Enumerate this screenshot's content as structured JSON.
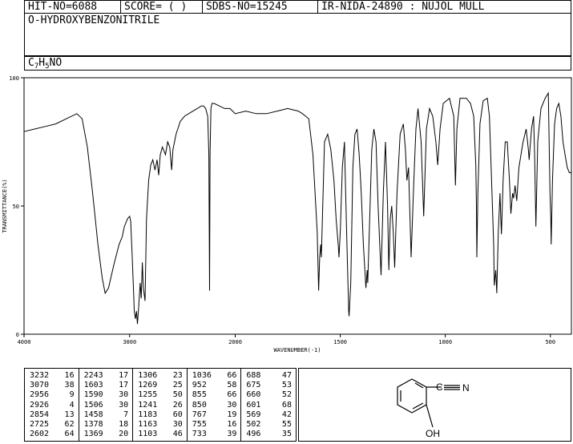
{
  "header": {
    "hit_no": "HIT-NO=6088",
    "score": "SCORE=  (  )",
    "sdbs_no": "SDBS-NO=15245",
    "ir_nida": "IR-NIDA-24890 : NUJOL MULL"
  },
  "compound": {
    "name": "O-HYDROXYBENZONITRILE",
    "formula_c": "C",
    "formula_c_sub": "7",
    "formula_h": "H",
    "formula_h_sub": "5",
    "formula_rest": "NO"
  },
  "structure": {
    "nitrogen_label": "N",
    "hydroxyl_label": "OH"
  },
  "peak_table": {
    "columns": [
      [
        [
          "3232",
          "16"
        ],
        [
          "3070",
          "38"
        ],
        [
          "2956",
          "9"
        ],
        [
          "2926",
          "4"
        ],
        [
          "2854",
          "13"
        ],
        [
          "2725",
          "62"
        ],
        [
          "2602",
          "64"
        ]
      ],
      [
        [
          "2243",
          "17"
        ],
        [
          "1603",
          "17"
        ],
        [
          "1590",
          "30"
        ],
        [
          "1506",
          "30"
        ],
        [
          "1458",
          "7"
        ],
        [
          "1378",
          "18"
        ],
        [
          "1369",
          "20"
        ]
      ],
      [
        [
          "1306",
          "23"
        ],
        [
          "1269",
          "25"
        ],
        [
          "1255",
          "50"
        ],
        [
          "1241",
          "26"
        ],
        [
          "1183",
          "60"
        ],
        [
          "1163",
          "30"
        ],
        [
          "1103",
          "46"
        ]
      ],
      [
        [
          "1036",
          "66"
        ],
        [
          "952",
          "58"
        ],
        [
          "855",
          "66"
        ],
        [
          "850",
          "30"
        ],
        [
          "767",
          "19"
        ],
        [
          "755",
          "16"
        ],
        [
          "733",
          "39"
        ]
      ],
      [
        [
          "688",
          "47"
        ],
        [
          "675",
          "53"
        ],
        [
          "660",
          "52"
        ],
        [
          "601",
          "68"
        ],
        [
          "569",
          "42"
        ],
        [
          "502",
          "55"
        ],
        [
          "496",
          "35"
        ]
      ]
    ]
  },
  "chart_data": {
    "type": "line",
    "title": "",
    "xlabel": "WAVENUMBER(-1)",
    "ylabel": "TRANSMITTANCE(%)",
    "xlim": [
      4000,
      400
    ],
    "ylim": [
      0,
      100
    ],
    "x_ticks": [
      4000,
      3000,
      2000,
      1500,
      1000,
      500
    ],
    "y_ticks": [
      0,
      50,
      100
    ],
    "grid": false,
    "series": [
      {
        "color": "#000000",
        "points": [
          [
            4000,
            79
          ],
          [
            3900,
            80
          ],
          [
            3800,
            81
          ],
          [
            3700,
            82
          ],
          [
            3600,
            84
          ],
          [
            3500,
            86
          ],
          [
            3450,
            84
          ],
          [
            3400,
            73
          ],
          [
            3350,
            55
          ],
          [
            3300,
            35
          ],
          [
            3260,
            22
          ],
          [
            3232,
            16
          ],
          [
            3200,
            18
          ],
          [
            3150,
            27
          ],
          [
            3100,
            35
          ],
          [
            3070,
            38
          ],
          [
            3050,
            42
          ],
          [
            3020,
            45
          ],
          [
            3000,
            46
          ],
          [
            2990,
            44
          ],
          [
            2975,
            30
          ],
          [
            2960,
            14
          ],
          [
            2956,
            9
          ],
          [
            2945,
            6
          ],
          [
            2935,
            9
          ],
          [
            2926,
            4
          ],
          [
            2915,
            10
          ],
          [
            2900,
            20
          ],
          [
            2890,
            14
          ],
          [
            2880,
            28
          ],
          [
            2870,
            18
          ],
          [
            2860,
            15
          ],
          [
            2854,
            13
          ],
          [
            2840,
            45
          ],
          [
            2820,
            60
          ],
          [
            2800,
            66
          ],
          [
            2780,
            68
          ],
          [
            2760,
            64
          ],
          [
            2740,
            68
          ],
          [
            2725,
            62
          ],
          [
            2710,
            70
          ],
          [
            2690,
            73
          ],
          [
            2660,
            70
          ],
          [
            2640,
            75
          ],
          [
            2620,
            73
          ],
          [
            2602,
            64
          ],
          [
            2590,
            72
          ],
          [
            2560,
            78
          ],
          [
            2520,
            83
          ],
          [
            2480,
            85
          ],
          [
            2440,
            86
          ],
          [
            2400,
            87
          ],
          [
            2360,
            88
          ],
          [
            2320,
            89
          ],
          [
            2300,
            89
          ],
          [
            2280,
            88
          ],
          [
            2260,
            85
          ],
          [
            2250,
            70
          ],
          [
            2243,
            17
          ],
          [
            2238,
            70
          ],
          [
            2230,
            88
          ],
          [
            2220,
            90
          ],
          [
            2200,
            90
          ],
          [
            2150,
            89
          ],
          [
            2100,
            88
          ],
          [
            2050,
            88
          ],
          [
            2000,
            86
          ],
          [
            1950,
            87
          ],
          [
            1900,
            86
          ],
          [
            1850,
            86
          ],
          [
            1800,
            87
          ],
          [
            1750,
            88
          ],
          [
            1700,
            87
          ],
          [
            1680,
            86
          ],
          [
            1650,
            84
          ],
          [
            1630,
            70
          ],
          [
            1610,
            40
          ],
          [
            1603,
            17
          ],
          [
            1598,
            30
          ],
          [
            1593,
            35
          ],
          [
            1590,
            30
          ],
          [
            1585,
            45
          ],
          [
            1575,
            75
          ],
          [
            1560,
            78
          ],
          [
            1545,
            72
          ],
          [
            1530,
            60
          ],
          [
            1520,
            45
          ],
          [
            1510,
            35
          ],
          [
            1506,
            30
          ],
          [
            1500,
            40
          ],
          [
            1490,
            65
          ],
          [
            1480,
            75
          ],
          [
            1470,
            40
          ],
          [
            1460,
            9
          ],
          [
            1458,
            7
          ],
          [
            1450,
            20
          ],
          [
            1440,
            65
          ],
          [
            1430,
            78
          ],
          [
            1420,
            80
          ],
          [
            1410,
            70
          ],
          [
            1400,
            55
          ],
          [
            1390,
            35
          ],
          [
            1378,
            18
          ],
          [
            1372,
            25
          ],
          [
            1369,
            20
          ],
          [
            1360,
            45
          ],
          [
            1350,
            72
          ],
          [
            1340,
            80
          ],
          [
            1330,
            75
          ],
          [
            1320,
            50
          ],
          [
            1306,
            23
          ],
          [
            1295,
            55
          ],
          [
            1285,
            75
          ],
          [
            1275,
            50
          ],
          [
            1269,
            25
          ],
          [
            1262,
            45
          ],
          [
            1255,
            50
          ],
          [
            1248,
            40
          ],
          [
            1241,
            26
          ],
          [
            1230,
            55
          ],
          [
            1215,
            78
          ],
          [
            1200,
            82
          ],
          [
            1190,
            72
          ],
          [
            1183,
            60
          ],
          [
            1175,
            65
          ],
          [
            1163,
            30
          ],
          [
            1150,
            60
          ],
          [
            1140,
            80
          ],
          [
            1130,
            88
          ],
          [
            1115,
            75
          ],
          [
            1103,
            46
          ],
          [
            1090,
            80
          ],
          [
            1075,
            88
          ],
          [
            1060,
            85
          ],
          [
            1045,
            75
          ],
          [
            1036,
            66
          ],
          [
            1025,
            80
          ],
          [
            1010,
            90
          ],
          [
            980,
            92
          ],
          [
            960,
            85
          ],
          [
            952,
            58
          ],
          [
            945,
            80
          ],
          [
            930,
            92
          ],
          [
            900,
            92
          ],
          [
            880,
            90
          ],
          [
            865,
            85
          ],
          [
            855,
            66
          ],
          [
            852,
            50
          ],
          [
            850,
            30
          ],
          [
            845,
            55
          ],
          [
            835,
            82
          ],
          [
            820,
            91
          ],
          [
            800,
            92
          ],
          [
            790,
            85
          ],
          [
            780,
            60
          ],
          [
            770,
            35
          ],
          [
            767,
            19
          ],
          [
            760,
            25
          ],
          [
            755,
            16
          ],
          [
            748,
            40
          ],
          [
            740,
            55
          ],
          [
            736,
            45
          ],
          [
            733,
            39
          ],
          [
            725,
            60
          ],
          [
            715,
            75
          ],
          [
            705,
            75
          ],
          [
            695,
            60
          ],
          [
            688,
            47
          ],
          [
            680,
            55
          ],
          [
            675,
            53
          ],
          [
            668,
            58
          ],
          [
            660,
            52
          ],
          [
            650,
            65
          ],
          [
            630,
            75
          ],
          [
            615,
            80
          ],
          [
            605,
            72
          ],
          [
            601,
            68
          ],
          [
            590,
            80
          ],
          [
            580,
            85
          ],
          [
            575,
            70
          ],
          [
            569,
            42
          ],
          [
            560,
            75
          ],
          [
            545,
            88
          ],
          [
            525,
            92
          ],
          [
            510,
            94
          ],
          [
            505,
            70
          ],
          [
            502,
            55
          ],
          [
            498,
            45
          ],
          [
            496,
            35
          ],
          [
            490,
            60
          ],
          [
            480,
            82
          ],
          [
            470,
            88
          ],
          [
            460,
            90
          ],
          [
            450,
            85
          ],
          [
            440,
            75
          ],
          [
            430,
            70
          ],
          [
            420,
            65
          ],
          [
            410,
            63
          ],
          [
            400,
            63
          ]
        ]
      }
    ]
  }
}
